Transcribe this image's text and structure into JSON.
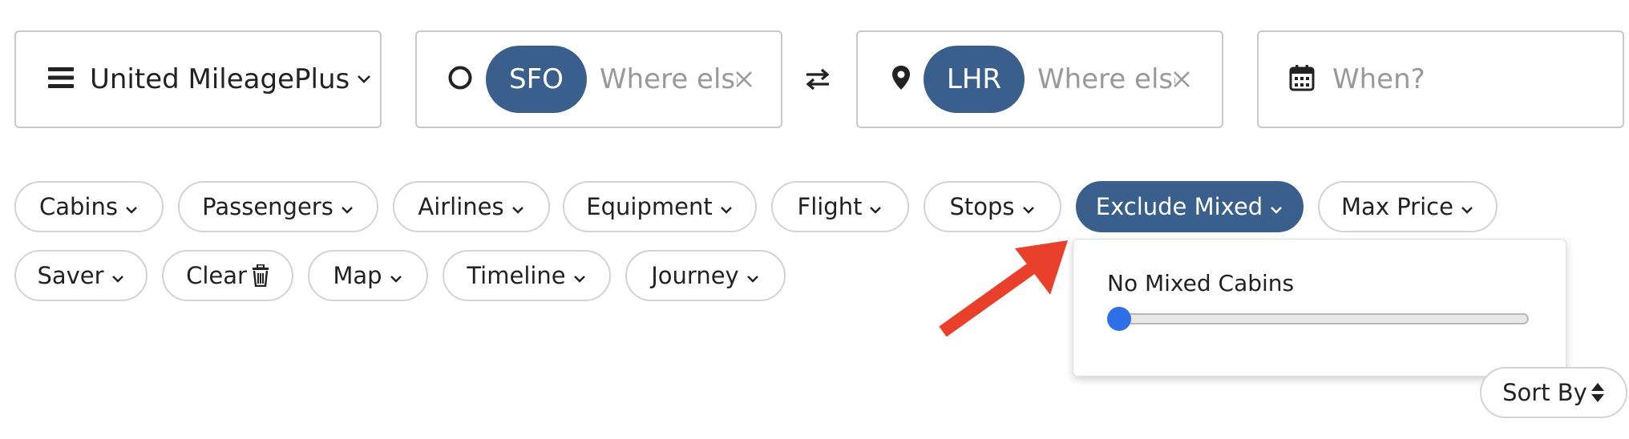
{
  "search": {
    "program": {
      "label": "United MileagePlus",
      "icon": "hamburger-menu-icon"
    },
    "origin": {
      "code": "SFO",
      "placeholder": "Where else",
      "icon": "circle-icon"
    },
    "destination": {
      "code": "LHR",
      "placeholder": "Where else",
      "icon": "map-pin-icon"
    },
    "swap_icon": "swap-arrows-icon",
    "when": {
      "placeholder": "When?",
      "icon": "calendar-icon"
    }
  },
  "filters": {
    "row1": [
      {
        "label": "Cabins"
      },
      {
        "label": "Passengers"
      },
      {
        "label": "Airlines"
      },
      {
        "label": "Equipment"
      },
      {
        "label": "Flight"
      },
      {
        "label": "Stops"
      },
      {
        "label": "Exclude Mixed",
        "active": true
      },
      {
        "label": "Max Price"
      }
    ],
    "row2": [
      {
        "label": "Saver"
      },
      {
        "label": "Clear",
        "icon": "trash-icon"
      },
      {
        "label": "Map"
      },
      {
        "label": "Timeline"
      },
      {
        "label": "Journey"
      }
    ]
  },
  "exclude_mixed_dropdown": {
    "title": "No Mixed Cabins",
    "slider_value": 0
  },
  "sort": {
    "label": "Sort By",
    "icon": "sort-icon"
  },
  "colors": {
    "accent": "#3a5f8c",
    "slider": "#2f6fe8",
    "annotation_arrow": "#e8402a"
  }
}
